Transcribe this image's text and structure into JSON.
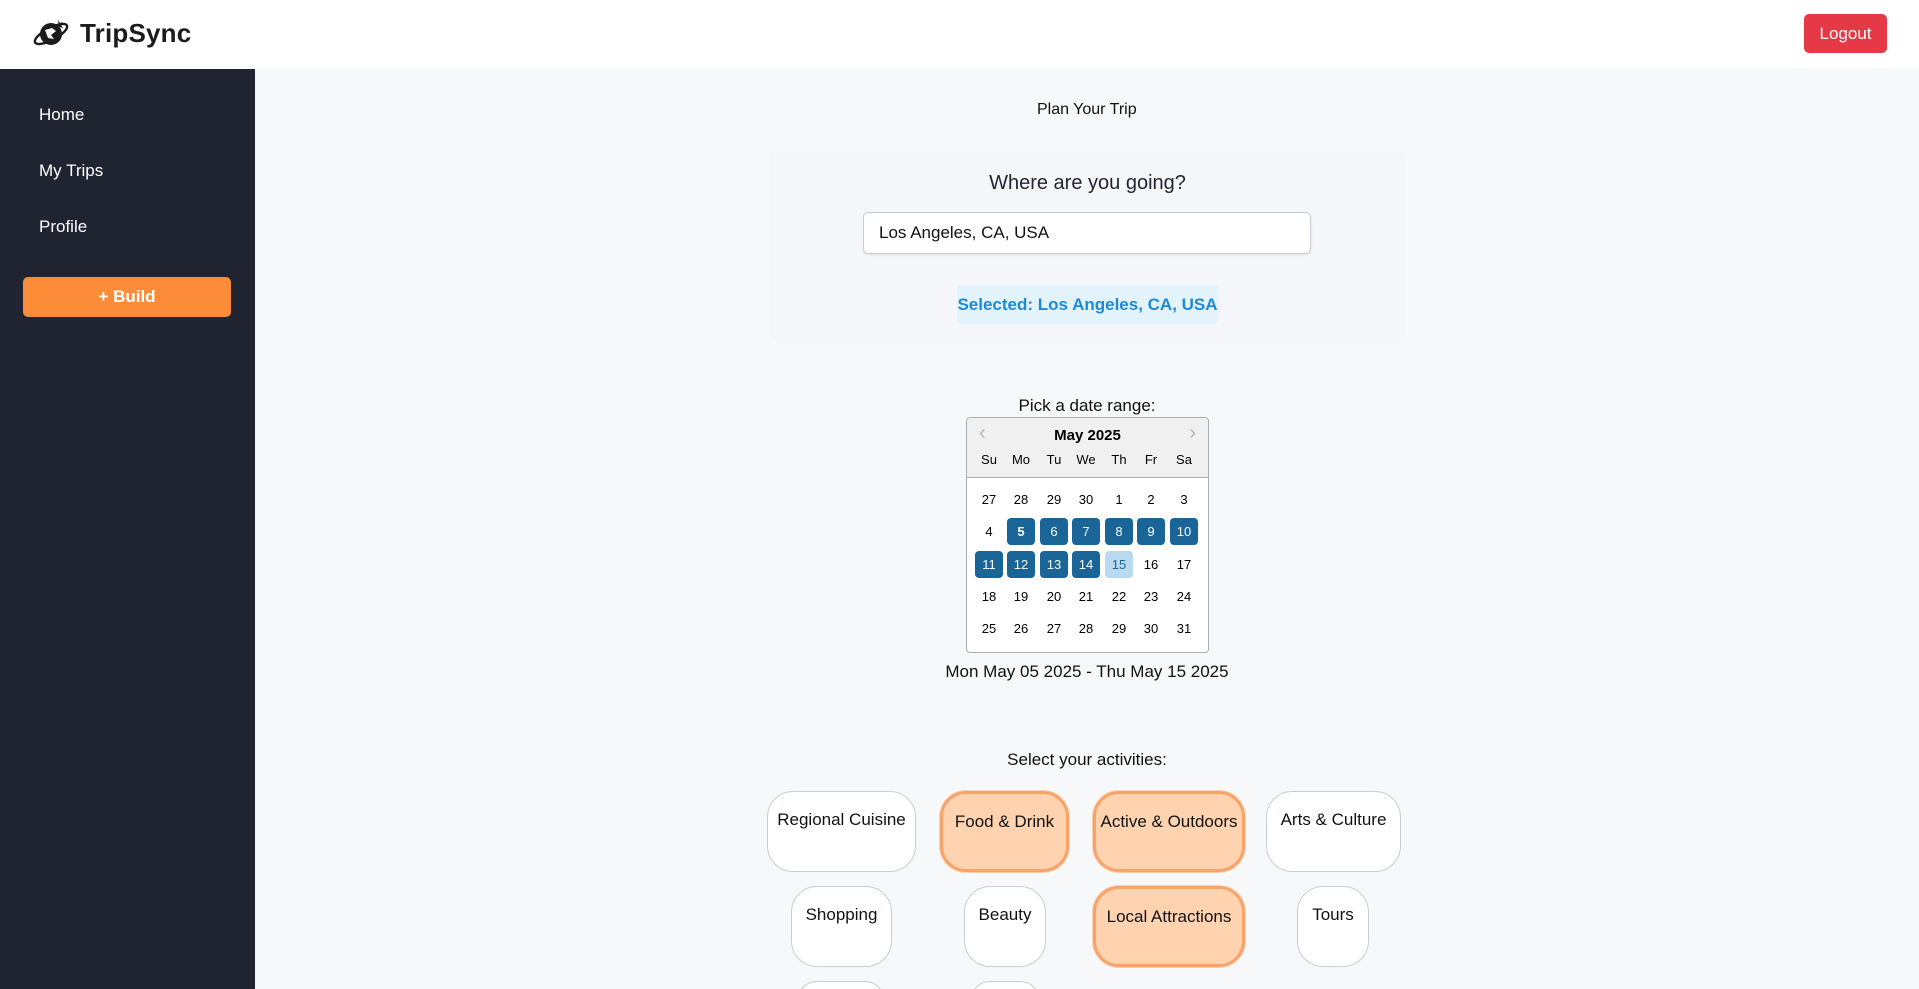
{
  "app": {
    "name": "TripSync",
    "logout_label": "Logout"
  },
  "sidebar": {
    "items": [
      {
        "label": "Home"
      },
      {
        "label": "My Trips"
      },
      {
        "label": "Profile"
      }
    ],
    "build_label": "+ Build"
  },
  "main": {
    "title": "Plan Your Trip",
    "destination": {
      "question": "Where are you going?",
      "input_value": "Los Angeles, CA, USA",
      "selected_text": "Selected: Los Angeles, CA, USA"
    },
    "dates": {
      "label": "Pick a date range:",
      "month_label": "May 2025",
      "day_names": [
        "Su",
        "Mo",
        "Tu",
        "We",
        "Th",
        "Fr",
        "Sa"
      ],
      "weeks": [
        [
          "27",
          "28",
          "29",
          "30",
          "1",
          "2",
          "3"
        ],
        [
          "4",
          "5",
          "6",
          "7",
          "8",
          "9",
          "10"
        ],
        [
          "11",
          "12",
          "13",
          "14",
          "15",
          "16",
          "17"
        ],
        [
          "18",
          "19",
          "20",
          "21",
          "22",
          "23",
          "24"
        ],
        [
          "25",
          "26",
          "27",
          "28",
          "29",
          "30",
          "31"
        ]
      ],
      "range_text": "Mon May 05 2025 - Thu May 15 2025"
    },
    "activities": {
      "label": "Select your activities:",
      "items": [
        {
          "label": "Regional Cuisine",
          "selected": false
        },
        {
          "label": "Food & Drink",
          "selected": true
        },
        {
          "label": "Active & Outdoors",
          "selected": true
        },
        {
          "label": "Arts & Culture",
          "selected": false
        },
        {
          "label": "Shopping",
          "selected": false
        },
        {
          "label": "Beauty",
          "selected": false
        },
        {
          "label": "Local Attractions",
          "selected": true
        },
        {
          "label": "Tours",
          "selected": false
        }
      ]
    }
  },
  "colors": {
    "sidebar_bg": "#1f2430",
    "build_orange": "#fc8c38",
    "logout_red": "#e53945",
    "calendar_selected": "#1a6598",
    "chip_selected_bg": "#ffd3b0",
    "selected_badge_bg": "#e2f3fc"
  }
}
